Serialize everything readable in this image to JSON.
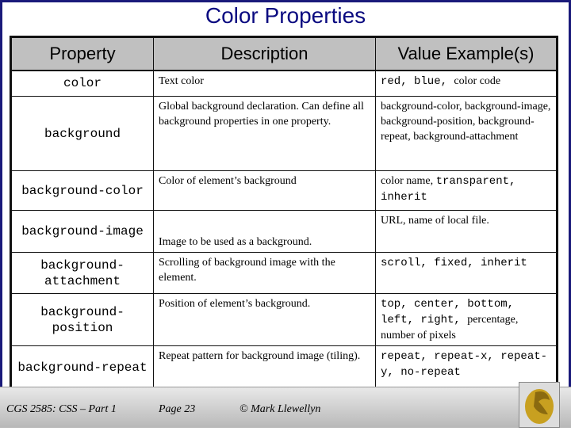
{
  "title": "Color Properties",
  "headers": [
    "Property",
    "Description",
    "Value Example(s)"
  ],
  "rows": [
    {
      "property": "color",
      "description": "Text color",
      "value": [
        {
          "t": "red, blue, ",
          "m": true
        },
        {
          "t": "color code",
          "m": false
        }
      ]
    },
    {
      "property": "background",
      "description": "Global background declaration.  Can define all background properties in one property.",
      "value": [
        {
          "t": "background-color, background-image, background-position, background-repeat, background-attachment",
          "m": false
        }
      ]
    },
    {
      "property": "background-color",
      "description": "Color of element’s background",
      "value": [
        {
          "t": "color name, ",
          "m": false
        },
        {
          "t": "transparent, inherit",
          "m": true
        }
      ]
    },
    {
      "property": "background-image",
      "description": "Image to be used as a background.",
      "value": [
        {
          "t": "URL, name of local file.",
          "m": false
        }
      ]
    },
    {
      "property": "background-attachment",
      "description": "Scrolling of background image with the element.",
      "value": [
        {
          "t": "scroll, fixed, inherit",
          "m": true
        }
      ]
    },
    {
      "property": "background-position",
      "description": "Position of element’s background.",
      "value": [
        {
          "t": "top, center, bottom, left, right, ",
          "m": true
        },
        {
          "t": "percentage, number of pixels",
          "m": false
        }
      ]
    },
    {
      "property": "background-repeat",
      "description": "Repeat pattern for background image (tiling).",
      "value": [
        {
          "t": "repeat, repeat-x, repeat-y, no-repeat",
          "m": true
        }
      ]
    }
  ],
  "footer": {
    "course": "CGS 2585: CSS – Part 1",
    "page": "Page 23",
    "author": "© Mark Llewellyn"
  },
  "colors": {
    "border": "#1a1a7a",
    "title": "#0a0a80",
    "header_bg": "#c0c0c0",
    "logo": "#c8a020"
  }
}
